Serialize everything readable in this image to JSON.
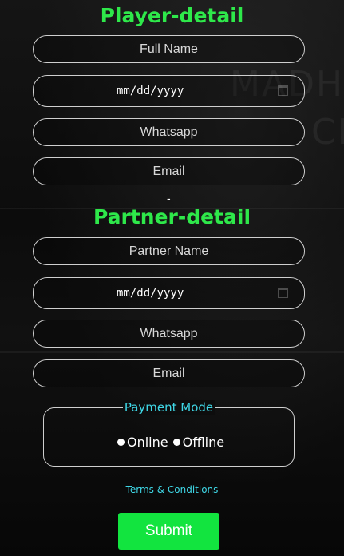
{
  "player": {
    "heading": "Player-detail",
    "full_name_placeholder": "Full Name",
    "dob_placeholder": "mm/dd/yyyy",
    "whatsapp_placeholder": "Whatsapp",
    "email_placeholder": "Email"
  },
  "separator": "-",
  "partner": {
    "heading": "Partner-detail",
    "name_placeholder": "Partner Name",
    "dob_placeholder": "mm/dd/yyyy",
    "whatsapp_placeholder": "Whatsapp",
    "email_placeholder": "Email"
  },
  "payment": {
    "legend": "Payment Mode",
    "options": [
      {
        "label": "Online",
        "selected": false
      },
      {
        "label": "Offline",
        "selected": false
      }
    ]
  },
  "terms_link": "Terms & Conditions",
  "submit_label": "Submit",
  "colors": {
    "heading": "#2ee84a",
    "accent": "#3fd7e6",
    "submit": "#12e43f",
    "background": "#0a0a0a"
  },
  "icons": {
    "date_picker": "calendar-icon",
    "radio": "radio-button"
  }
}
